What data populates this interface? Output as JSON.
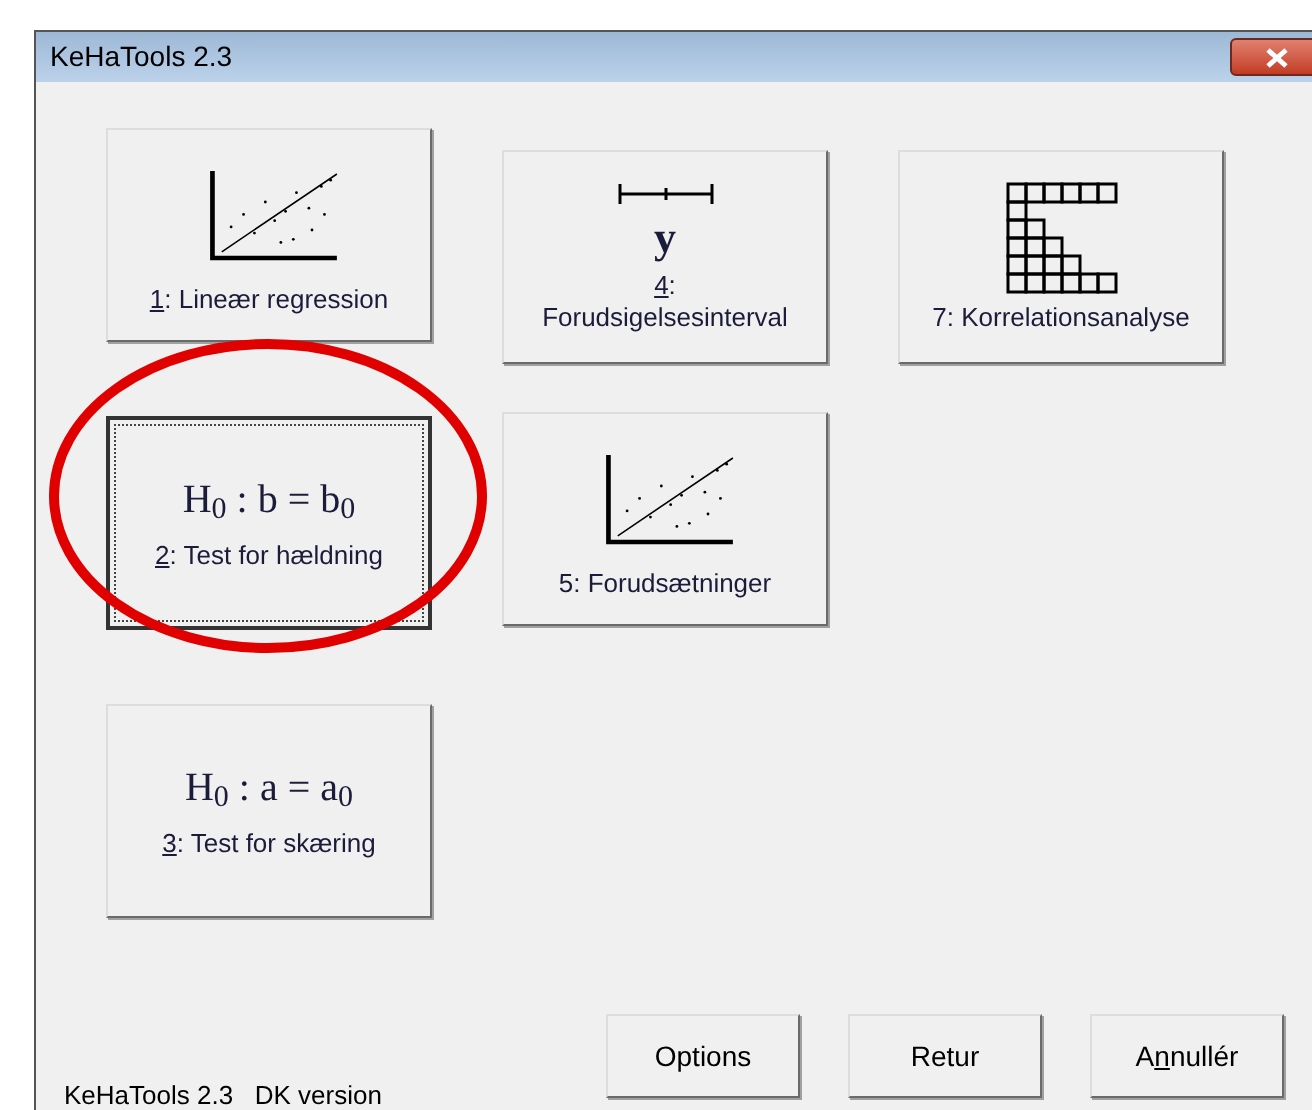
{
  "window": {
    "title": "KeHaTools 2.3"
  },
  "columns": [
    [
      {
        "kind": "scatter",
        "label": {
          "key": "1",
          "post": ": Lineær regression"
        },
        "focused": false,
        "circled": false
      },
      {
        "kind": "formula",
        "formula": "H$_{0}$ : b = b$_{0}$",
        "label": {
          "key": "2",
          "post": ": Test for hældning"
        },
        "focused": true,
        "circled": true
      },
      {
        "kind": "formula",
        "formula": "H$_{0}$ : a = a$_{0}$",
        "label": {
          "key": "3",
          "post": ": Test for skæring"
        },
        "focused": false,
        "circled": false
      }
    ],
    [
      {
        "kind": "interval",
        "symbol": "y",
        "label": {
          "key": "4",
          "post": ":"
        },
        "label_2": "Forudsigelsesinterval",
        "focused": false,
        "circled": false
      },
      {
        "kind": "scatter",
        "label": {
          "pre": "5: Forudsætninger"
        },
        "focused": false,
        "circled": false
      }
    ],
    [
      {
        "kind": "grid",
        "label": {
          "pre": "7: Korrelationsanalyse"
        },
        "focused": false,
        "circled": false
      }
    ]
  ],
  "status": "KeHaTools 2.3   DK version",
  "buttons": [
    {
      "label": {
        "pre": "Options"
      }
    },
    {
      "label": {
        "pre": "Retur"
      }
    },
    {
      "label": {
        "pre": "A",
        "key": "n",
        "post": "nullér"
      }
    }
  ]
}
